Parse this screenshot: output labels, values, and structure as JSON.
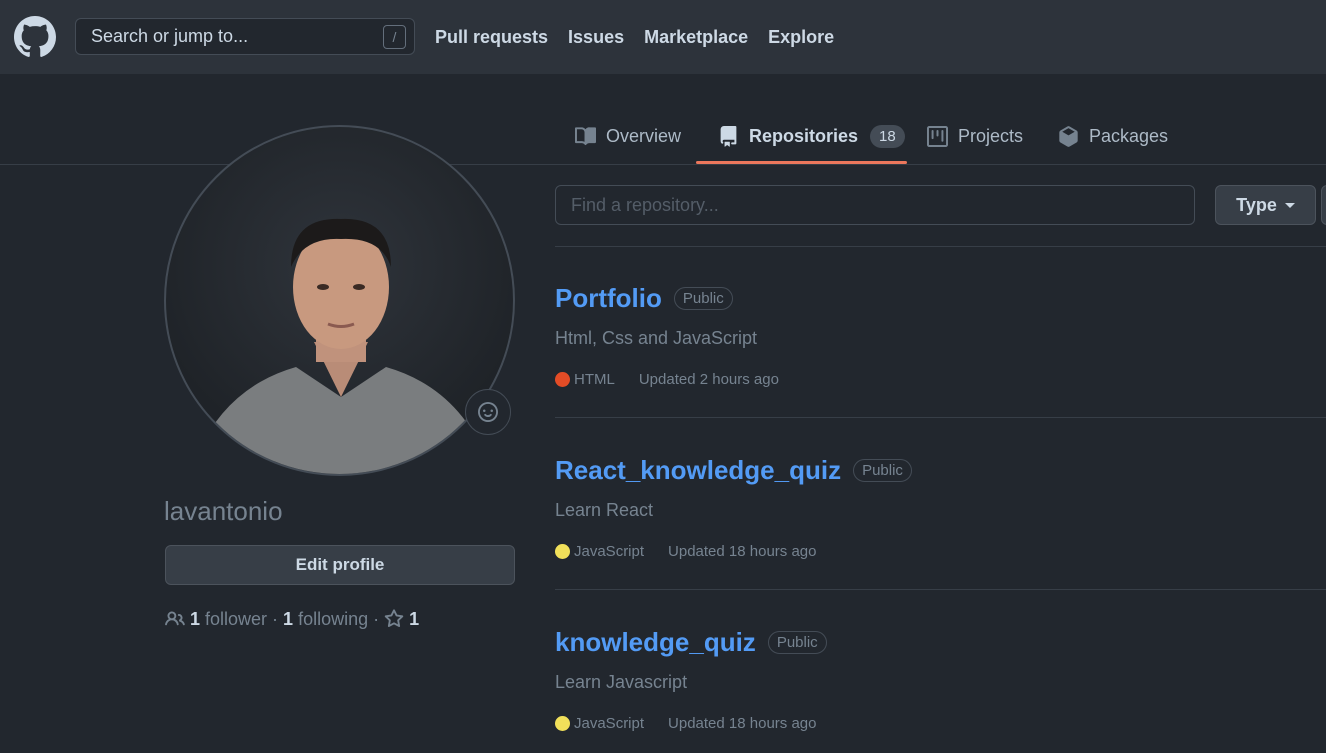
{
  "header": {
    "search_placeholder": "Search or jump to...",
    "search_shortcut": "/",
    "nav": [
      "Pull requests",
      "Issues",
      "Marketplace",
      "Explore"
    ]
  },
  "tabs": {
    "overview": "Overview",
    "repositories": "Repositories",
    "repositories_count": "18",
    "projects": "Projects",
    "packages": "Packages"
  },
  "profile": {
    "username": "lavantonio",
    "edit_label": "Edit profile",
    "followers_count": "1",
    "followers_label": "follower",
    "following_count": "1",
    "following_label": "following",
    "stars_count": "1"
  },
  "filter": {
    "find_placeholder": "Find a repository...",
    "type_label": "Type"
  },
  "repos": [
    {
      "name": "Portfolio",
      "visibility": "Public",
      "description": "Html, Css and JavaScript",
      "language": "HTML",
      "language_color": "#e34c26",
      "updated": "Updated 2 hours ago"
    },
    {
      "name": "React_knowledge_quiz",
      "visibility": "Public",
      "description": "Learn React",
      "language": "JavaScript",
      "language_color": "#f1e05a",
      "updated": "Updated 18 hours ago"
    },
    {
      "name": "knowledge_quiz",
      "visibility": "Public",
      "description": "Learn Javascript",
      "language": "JavaScript",
      "language_color": "#f1e05a",
      "updated": "Updated 18 hours ago"
    }
  ],
  "colors": {
    "background": "#22272e",
    "header": "#2d333b",
    "link": "#539bf5",
    "tab_underline": "#ec775c"
  }
}
